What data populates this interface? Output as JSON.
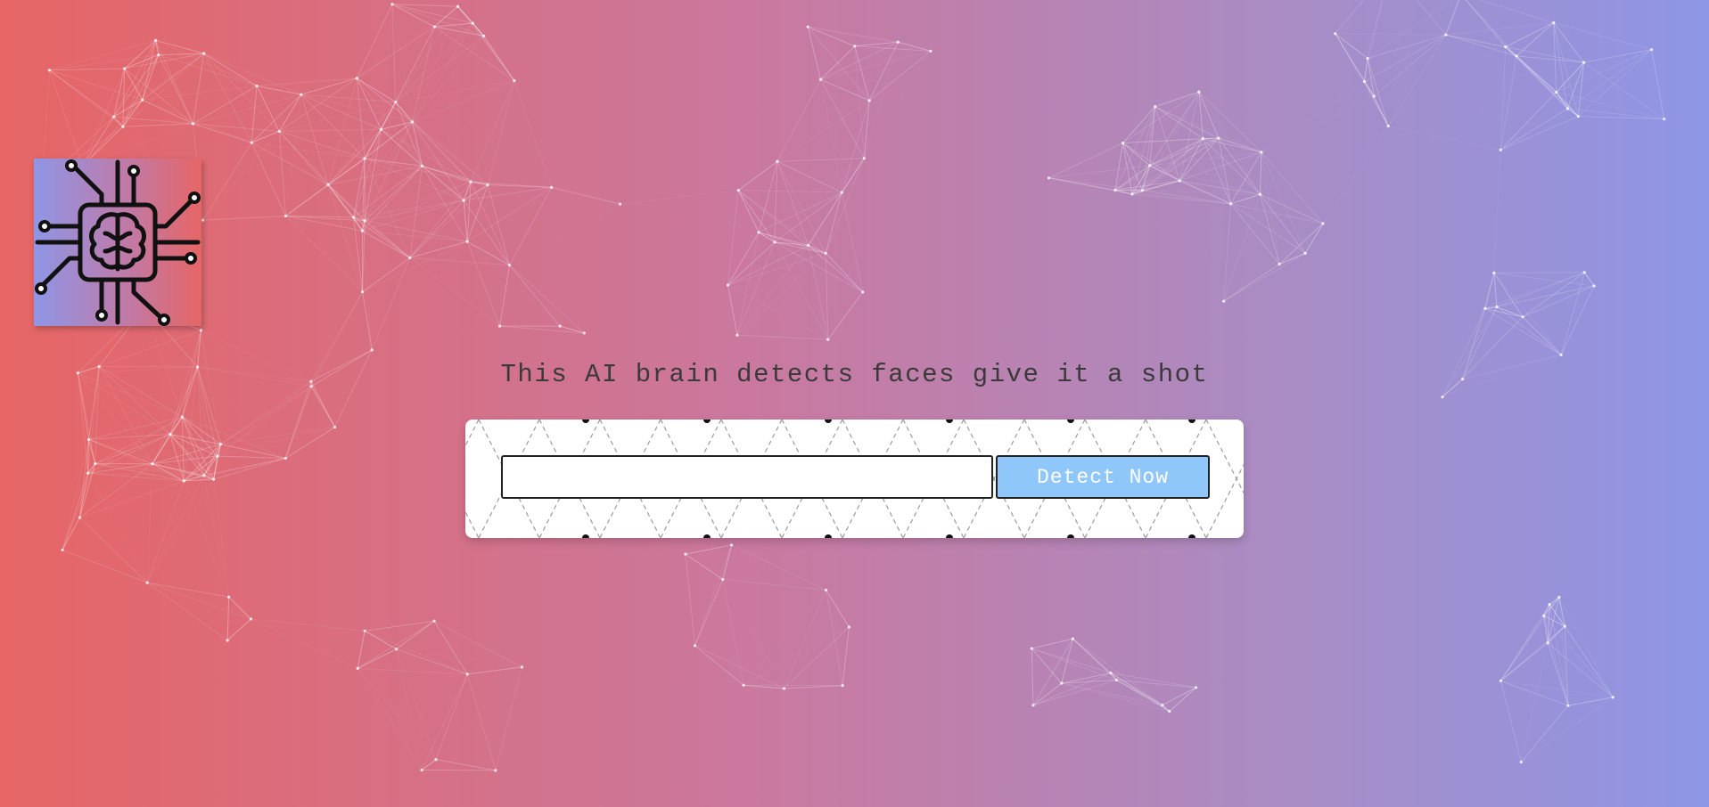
{
  "page": {
    "tagline": "This AI brain detects faces give it a shot"
  },
  "detect_form": {
    "input_value": "",
    "input_placeholder": "",
    "button_label": "Detect Now"
  },
  "logo": {
    "icon": "circuit-brain-icon"
  },
  "colors": {
    "gradient_left": "#e66565",
    "gradient_right": "#8e96e6",
    "button_bg": "#8fc7fb",
    "button_text": "#ffffff",
    "card_bg": "#ffffff"
  }
}
